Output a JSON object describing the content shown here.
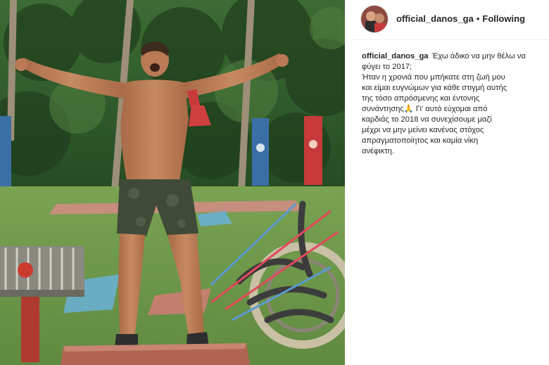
{
  "post": {
    "author": {
      "username": "official_danos_ga",
      "separator": "•",
      "follow_state": "Following"
    },
    "caption": {
      "username": "official_danos_ga",
      "first_line": "Έχω άδικο να μην θέλω να φύγει το 2017;",
      "body_lines": [
        "Ήταν η χρονιά που μπήκατε στη ζωή μου",
        "και είμαι ευγνώμων για κάθε στιγμή αυτής",
        "της τόσο απρόσμενης και έντονης",
        "συνάντησης🙏 Γι' αυτό εύχομαι από",
        "καρδιάς το 2018 να συνεχίσουμε μαζί",
        "μέχρι να μην μείνει κανένας στόχος",
        "απραγματοποίητος και καμία νίκη",
        "ανέφικτη."
      ]
    },
    "photo": {
      "subject": "shirtless man celebrating with arms raised on an outdoor obstacle course",
      "colors": {
        "trees": "#2f5a2c",
        "grass": "#6f9a4a",
        "skin": "#b97a55",
        "shorts": "#3f4a38",
        "flag_red": "#c63a3a",
        "flag_blue": "#3a6fa6"
      }
    }
  }
}
